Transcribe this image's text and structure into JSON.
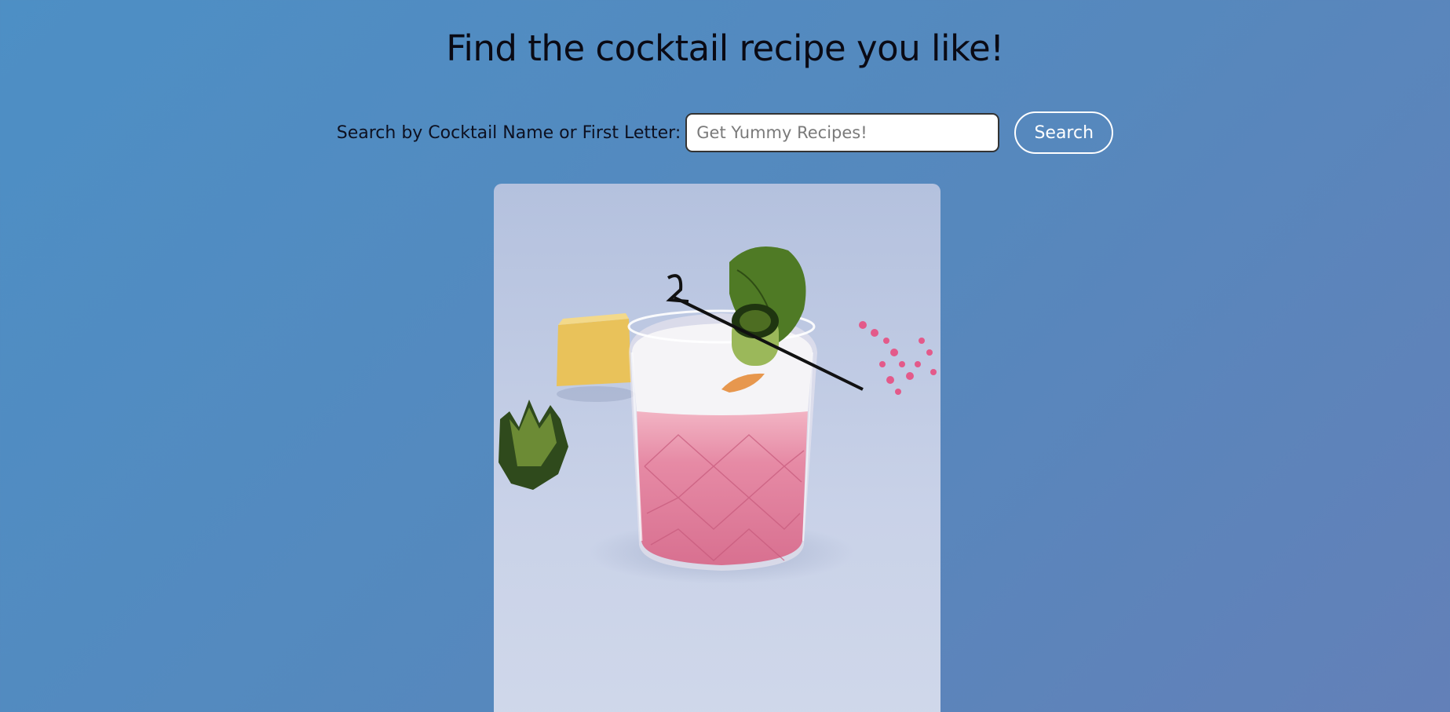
{
  "page": {
    "title": "Find the cocktail recipe you like!"
  },
  "search": {
    "label": "Search by Cocktail Name or First Letter:",
    "placeholder": "Get Yummy Recipes!",
    "value": "",
    "button_label": "Search"
  },
  "hero_image": {
    "subject": "pink cocktail in crystal glass with cucumber and mint garnish"
  },
  "colors": {
    "background_start": "#4d8fc5",
    "background_end": "#6380b8",
    "button_border": "#ffffff",
    "drink_pink": "#e07a97"
  }
}
